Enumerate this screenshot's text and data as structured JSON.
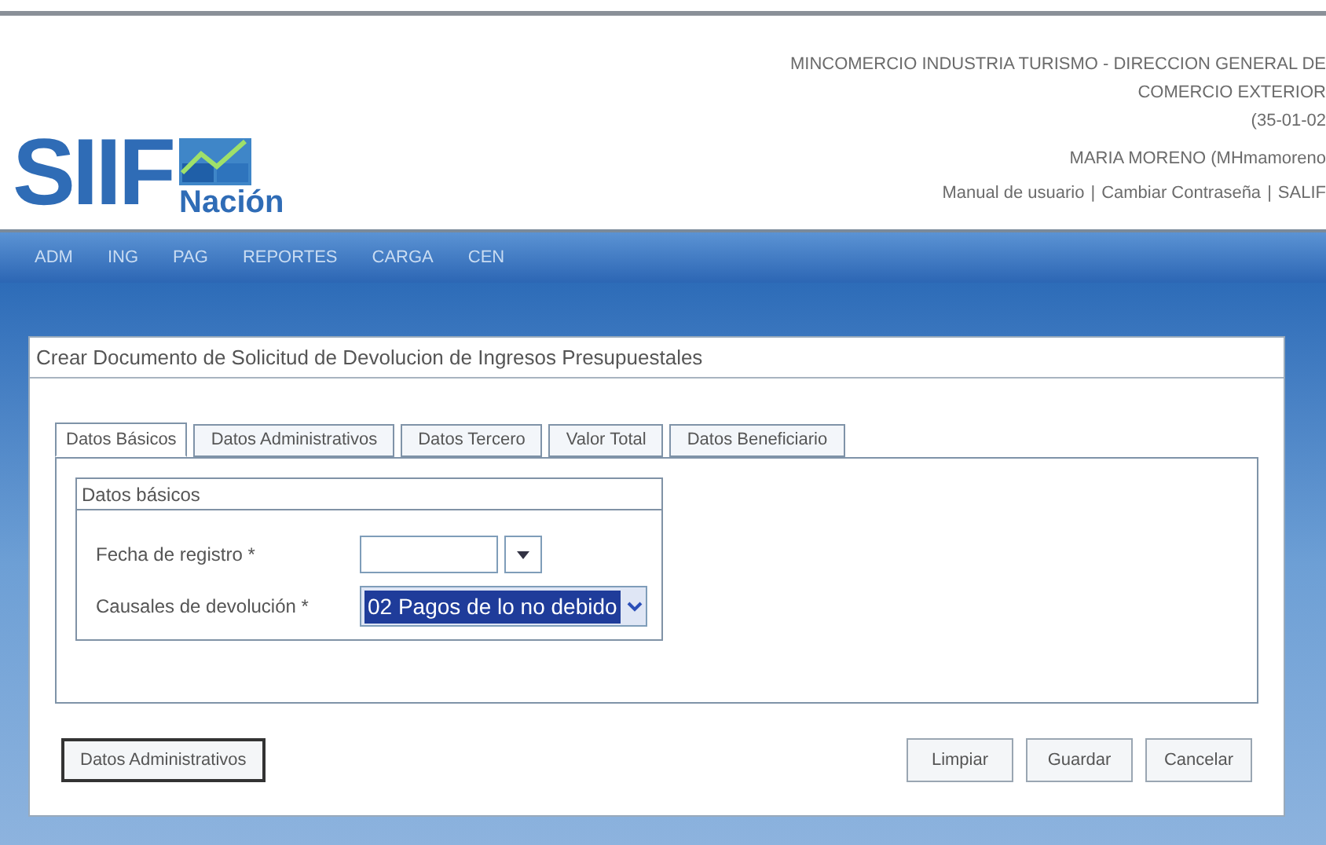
{
  "header": {
    "logo": {
      "wordmark": "SIIF",
      "subtitle": "Nación"
    },
    "entity_lines": [
      "MINCOMERCIO INDUSTRIA TURISMO - DIRECCION GENERAL DE",
      "COMERCIO EXTERIOR",
      "(35-01-02"
    ],
    "user": "MARIA MORENO (MHmamoreno",
    "links": [
      {
        "label": "Manual de usuario"
      },
      {
        "label": "Cambiar Contraseña"
      },
      {
        "label": "SALIF"
      }
    ],
    "separator": "|"
  },
  "nav": [
    {
      "label": "ADM"
    },
    {
      "label": "ING"
    },
    {
      "label": "PAG"
    },
    {
      "label": "REPORTES"
    },
    {
      "label": "CARGA"
    },
    {
      "label": "CEN"
    }
  ],
  "panel": {
    "title": "Crear Documento de Solicitud de Devolucion de Ingresos Presupuestales",
    "tabs": [
      {
        "label": "Datos Básicos",
        "selected": true
      },
      {
        "label": "Datos Administrativos",
        "selected": false
      },
      {
        "label": "Datos Tercero",
        "selected": false
      },
      {
        "label": "Valor Total",
        "selected": false
      },
      {
        "label": "Datos Beneficiario",
        "selected": false
      }
    ],
    "fieldset": {
      "legend": "Datos básicos",
      "fields": [
        {
          "kind": "date",
          "label": "Fecha de registro *"
        },
        {
          "kind": "select",
          "label": "Causales de devolución *",
          "value": "02 Pagos de lo no debido"
        }
      ]
    },
    "footer_left": "Datos Administrativos",
    "buttons": [
      "Limpiar",
      "Guardar",
      "Cancelar"
    ]
  }
}
